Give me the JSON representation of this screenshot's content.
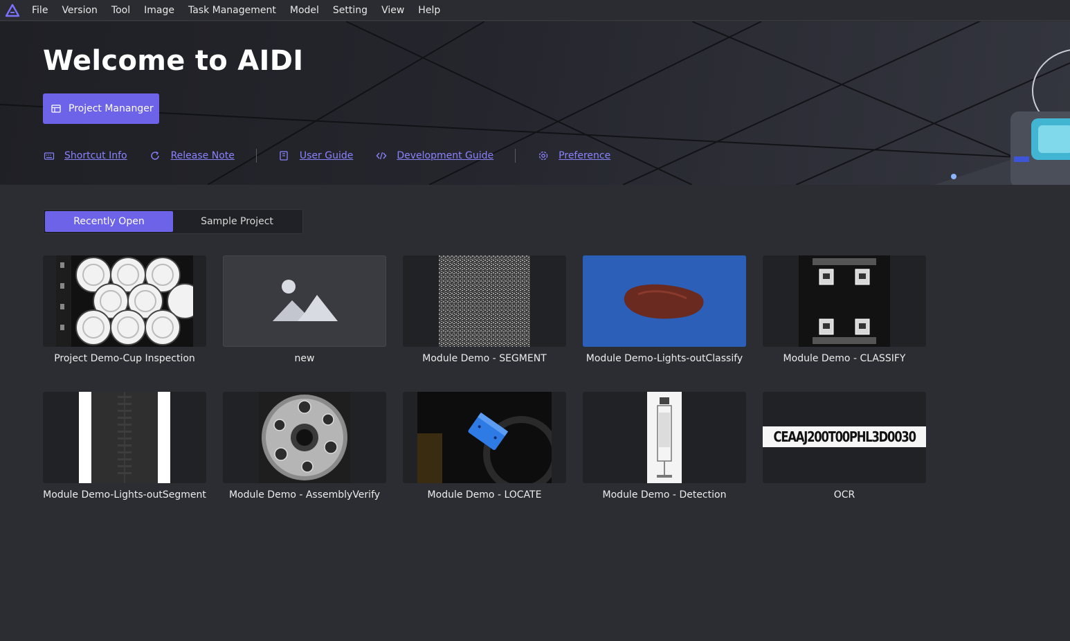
{
  "menubar": {
    "items": [
      "File",
      "Version",
      "Tool",
      "Image",
      "Task Management",
      "Model",
      "Setting",
      "View",
      "Help"
    ]
  },
  "hero": {
    "title": "Welcome to AIDI",
    "project_manager_label": "Project Mananger",
    "links": {
      "shortcut": "Shortcut Info",
      "release": "Release Note",
      "user_guide": "User Guide",
      "dev_guide": "Development Guide",
      "preference": "Preference"
    }
  },
  "tabs": {
    "recent": "Recently Open",
    "sample": "Sample Project"
  },
  "projects": [
    {
      "name": "Project Demo-Cup Inspection"
    },
    {
      "name": "new"
    },
    {
      "name": "Module Demo - SEGMENT"
    },
    {
      "name": "Module Demo-Lights-outClassify"
    },
    {
      "name": "Module Demo - CLASSIFY"
    },
    {
      "name": "Module Demo-Lights-outSegment"
    },
    {
      "name": "Module Demo - AssemblyVerify"
    },
    {
      "name": "Module Demo - LOCATE"
    },
    {
      "name": "Module Demo - Detection"
    },
    {
      "name": "OCR",
      "ocr_text": "CEAAJ200T00PHL3D0030"
    }
  ],
  "colors": {
    "accent": "#6d63e8",
    "link": "#8a83ff",
    "background": "#2c2d33"
  }
}
